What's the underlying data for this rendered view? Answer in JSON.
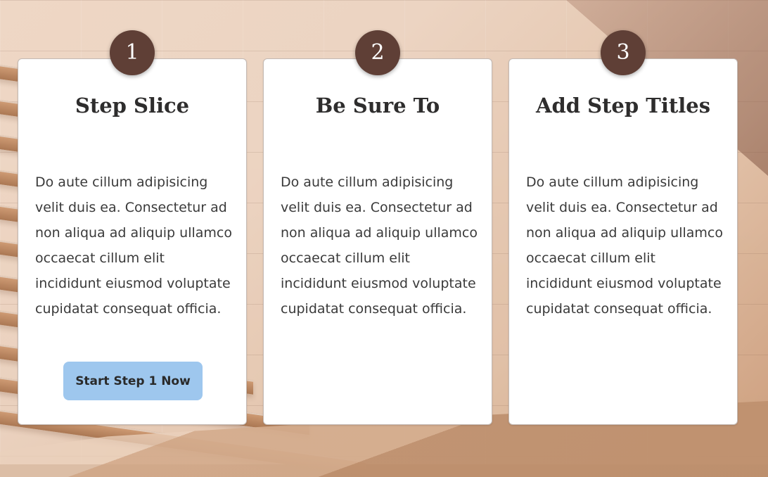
{
  "steps": [
    {
      "number": "1",
      "title": "Step Slice",
      "body": "Do aute cillum adipisicing velit duis ea. Consectetur ad non aliqua ad aliquip ullamco occaecat cillum elit incididunt eiusmod voluptate cupidatat consequat officia.",
      "button_label": "Start Step 1 Now"
    },
    {
      "number": "2",
      "title": "Be Sure To",
      "body": "Do aute cillum adipisicing velit duis ea. Consectetur ad non aliqua ad aliquip ullamco occaecat cillum elit incididunt eiusmod voluptate cupidatat consequat officia."
    },
    {
      "number": "3",
      "title": "Add Step Titles",
      "body": "Do aute cillum adipisicing velit duis ea. Consectetur ad non aliqua ad aliquip ullamco occaecat cillum elit incididunt eiusmod voluptate cupidatat consequat officia."
    }
  ],
  "colors": {
    "badge": "#5f3f36",
    "button": "#9ec7ee",
    "card": "#ffffff",
    "title_text": "#2e2d2d",
    "body_text": "#3a3a3a"
  }
}
